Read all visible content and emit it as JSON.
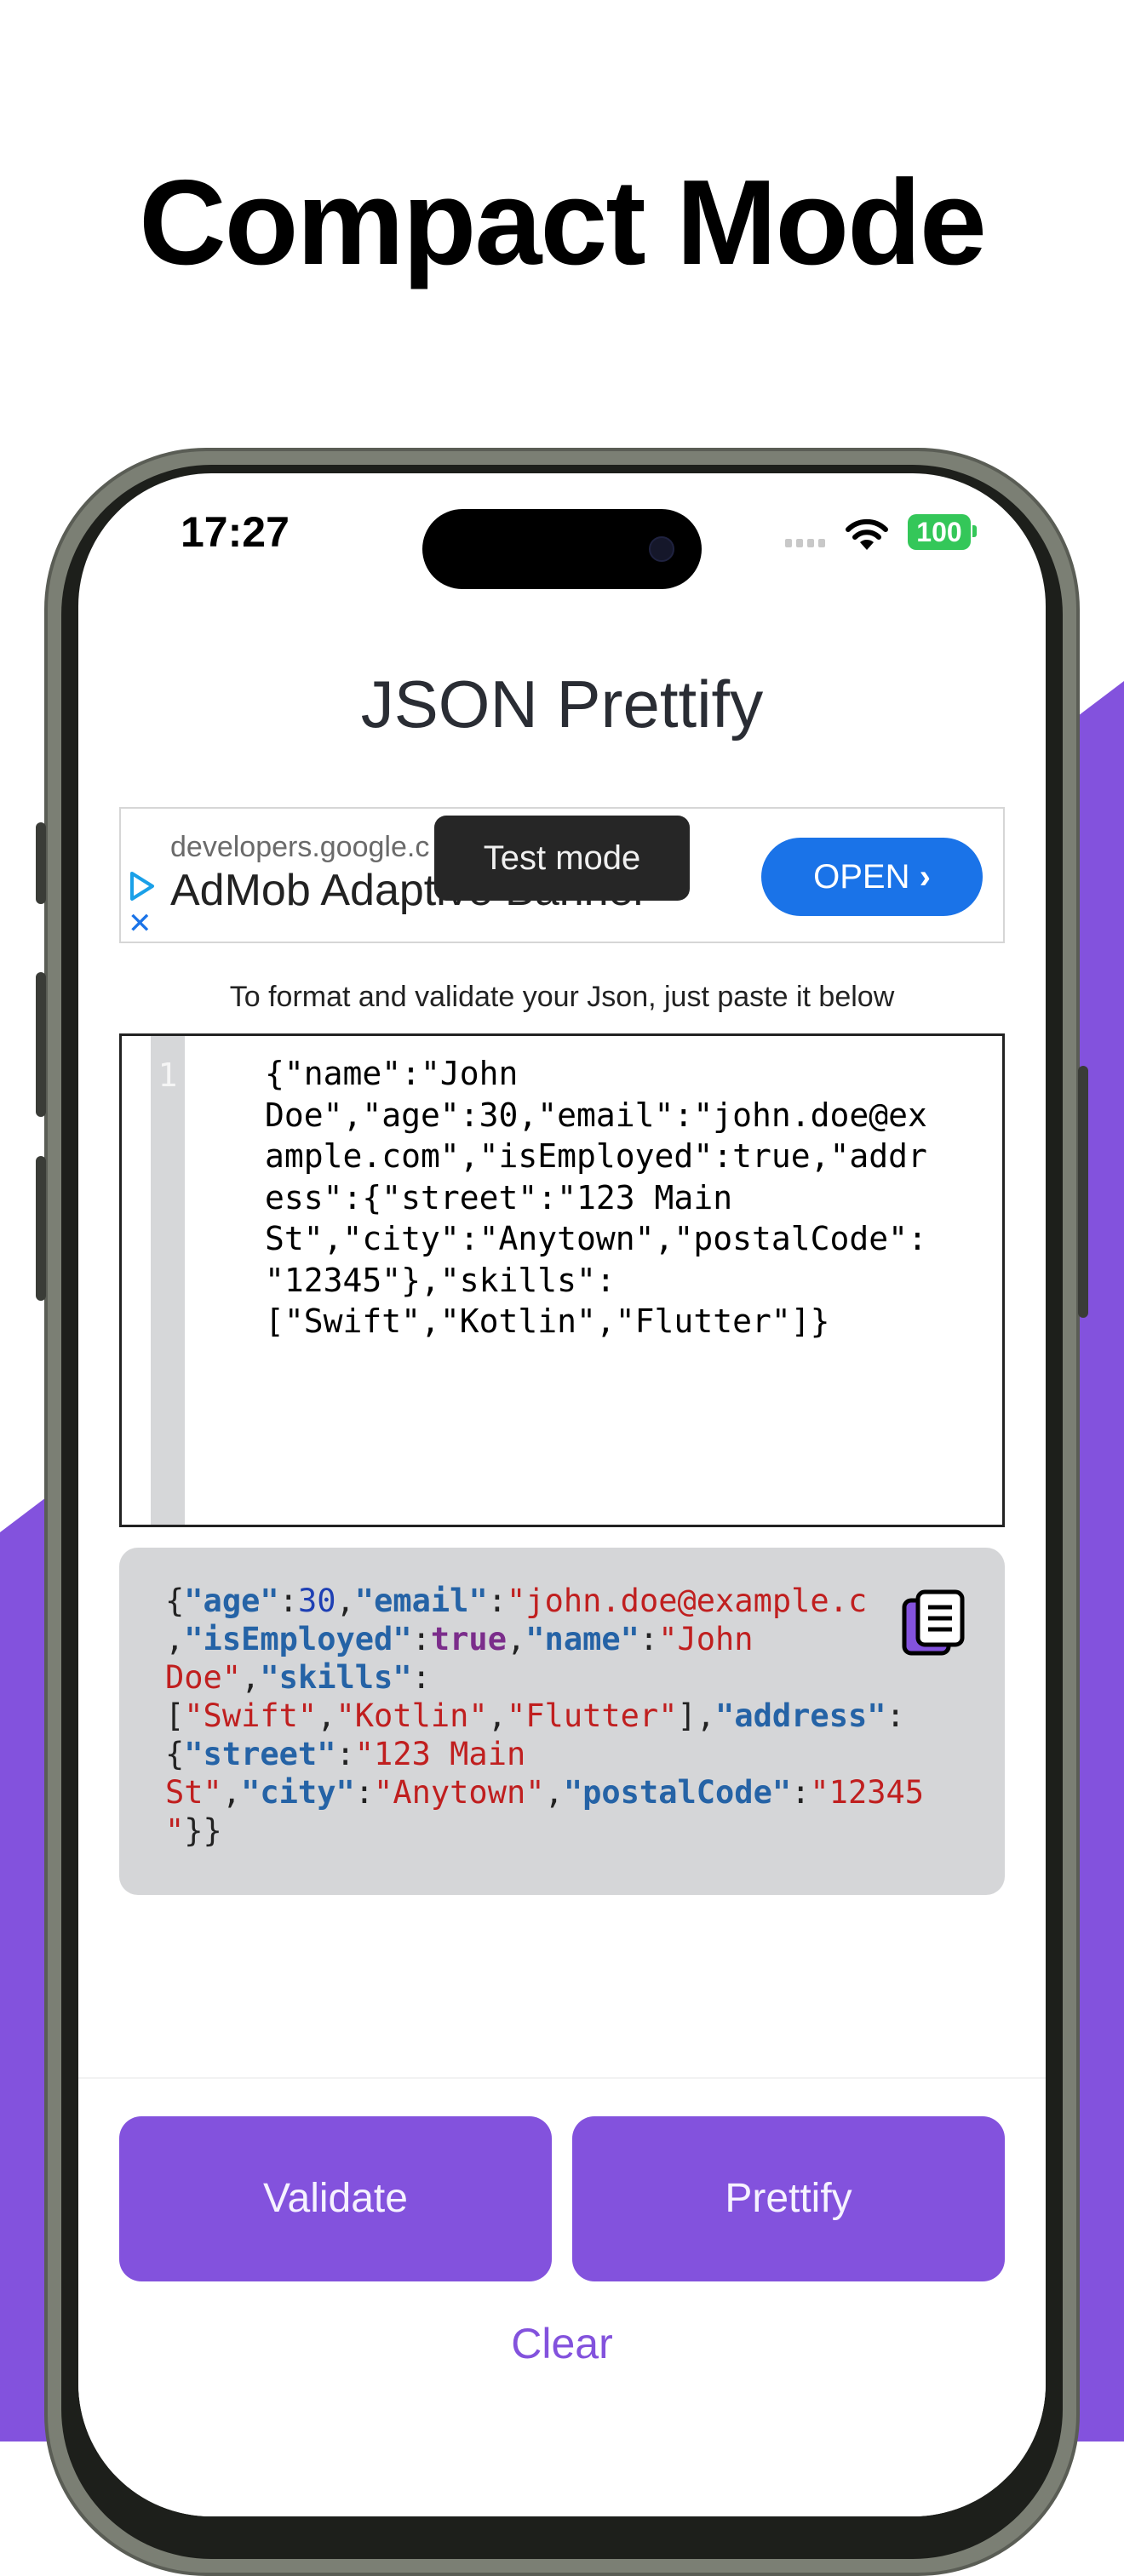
{
  "headline": "Compact Mode",
  "colors": {
    "accent": "#8352dd",
    "ad_button": "#1a73e8",
    "battery": "#34c759"
  },
  "status_bar": {
    "time": "17:27",
    "battery": "100"
  },
  "app": {
    "title": "JSON Prettify"
  },
  "ad": {
    "domain": "developers.google.c",
    "title": "AdMob Adaptive Banner",
    "open_label": "OPEN",
    "toast": "Test mode"
  },
  "instructions": "To format and validate your Json, just paste it below",
  "editor": {
    "line_number": "1",
    "text": "{\"name\":\"John\nDoe\",\"age\":30,\"email\":\"john.doe@ex\nample.com\",\"isEmployed\":true,\"addr\ness\":{\"street\":\"123 Main\nSt\",\"city\":\"Anytown\",\"postalCode\":\n\"12345\"},\"skills\":\n[\"Swift\",\"Kotlin\",\"Flutter\"]}"
  },
  "output": {
    "tokens": [
      {
        "t": "p",
        "v": "{"
      },
      {
        "t": "k",
        "v": "\"age\""
      },
      {
        "t": "p",
        "v": ":"
      },
      {
        "t": "n",
        "v": "30"
      },
      {
        "t": "p",
        "v": ","
      },
      {
        "t": "k",
        "v": "\"email\""
      },
      {
        "t": "p",
        "v": ":"
      },
      {
        "t": "s",
        "v": "\"john.doe@example.c"
      },
      {
        "t": "nl",
        "v": "\n"
      },
      {
        "t": "p",
        "v": ","
      },
      {
        "t": "k",
        "v": "\"isEmployed\""
      },
      {
        "t": "p",
        "v": ":"
      },
      {
        "t": "b",
        "v": "true"
      },
      {
        "t": "p",
        "v": ","
      },
      {
        "t": "k",
        "v": "\"name\""
      },
      {
        "t": "p",
        "v": ":"
      },
      {
        "t": "s",
        "v": "\"John"
      },
      {
        "t": "nl",
        "v": "\n"
      },
      {
        "t": "s",
        "v": "Doe\""
      },
      {
        "t": "p",
        "v": ","
      },
      {
        "t": "k",
        "v": "\"skills\""
      },
      {
        "t": "p",
        "v": ":"
      },
      {
        "t": "nl",
        "v": "\n"
      },
      {
        "t": "p",
        "v": "["
      },
      {
        "t": "s",
        "v": "\"Swift\""
      },
      {
        "t": "p",
        "v": ","
      },
      {
        "t": "s",
        "v": "\"Kotlin\""
      },
      {
        "t": "p",
        "v": ","
      },
      {
        "t": "s",
        "v": "\"Flutter\""
      },
      {
        "t": "p",
        "v": "],"
      },
      {
        "t": "k",
        "v": "\"address\""
      },
      {
        "t": "p",
        "v": ":"
      },
      {
        "t": "nl",
        "v": "\n"
      },
      {
        "t": "p",
        "v": "{"
      },
      {
        "t": "k",
        "v": "\"street\""
      },
      {
        "t": "p",
        "v": ":"
      },
      {
        "t": "s",
        "v": "\"123 Main"
      },
      {
        "t": "nl",
        "v": "\n"
      },
      {
        "t": "s",
        "v": "St\""
      },
      {
        "t": "p",
        "v": ","
      },
      {
        "t": "k",
        "v": "\"city\""
      },
      {
        "t": "p",
        "v": ":"
      },
      {
        "t": "s",
        "v": "\"Anytown\""
      },
      {
        "t": "p",
        "v": ","
      },
      {
        "t": "k",
        "v": "\"postalCode\""
      },
      {
        "t": "p",
        "v": ":"
      },
      {
        "t": "s",
        "v": "\"12345"
      },
      {
        "t": "nl",
        "v": "\n"
      },
      {
        "t": "s",
        "v": "\""
      },
      {
        "t": "p",
        "v": "}}"
      }
    ],
    "copy_icon": "copy-icon"
  },
  "buttons": {
    "validate": "Validate",
    "prettify": "Prettify",
    "clear": "Clear"
  }
}
